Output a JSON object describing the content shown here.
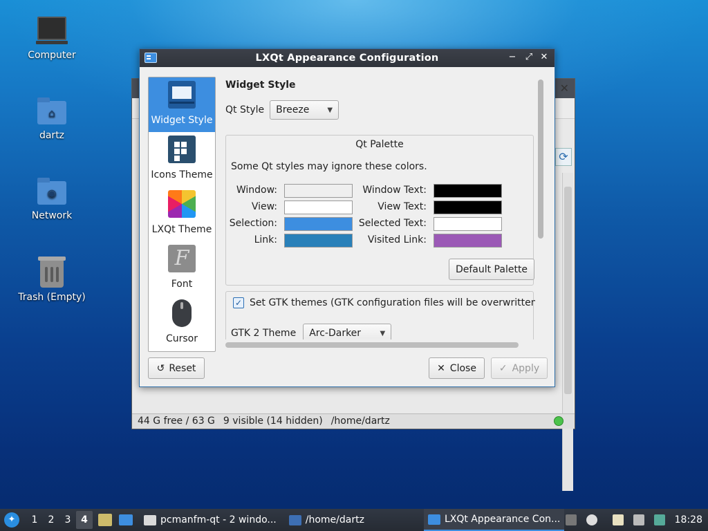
{
  "desktop": {
    "icons": [
      {
        "label": "Computer"
      },
      {
        "label": "dartz"
      },
      {
        "label": "Network"
      },
      {
        "label": "Trash (Empty)"
      }
    ]
  },
  "background_window": {
    "status": {
      "free": "44 G free / 63 G",
      "visible": "9 visible (14 hidden)",
      "path": "/home/dartz"
    }
  },
  "dialog": {
    "title": "LXQt Appearance Configuration",
    "sidebar": [
      {
        "label": "Widget Style",
        "icon": "widget-style-icon"
      },
      {
        "label": "Icons Theme",
        "icon": "icons-theme-icon"
      },
      {
        "label": "LXQt Theme",
        "icon": "lxqt-theme-icon"
      },
      {
        "label": "Font",
        "icon": "font-icon"
      },
      {
        "label": "Cursor",
        "icon": "cursor-icon"
      }
    ],
    "section_title": "Widget Style",
    "qt_style_label": "Qt Style",
    "qt_style_value": "Breeze",
    "palette": {
      "title": "Qt Palette",
      "hint": "Some Qt styles may ignore these colors.",
      "rows": [
        {
          "left_label": "Window:",
          "left_color": "#efefef",
          "right_label": "Window Text:",
          "right_color": "#000000"
        },
        {
          "left_label": "View:",
          "left_color": "#ffffff",
          "right_label": "View Text:",
          "right_color": "#000000"
        },
        {
          "left_label": "Selection:",
          "left_color": "#3d8ee0",
          "right_label": "Selected Text:",
          "right_color": "#ffffff"
        },
        {
          "left_label": "Link:",
          "left_color": "#2980b9",
          "right_label": "Visited Link:",
          "right_color": "#9b59b6"
        }
      ],
      "default_button": "Default Palette"
    },
    "gtk": {
      "checkbox_label": "Set GTK themes (GTK configuration files will be overwritten!)",
      "checked": true,
      "gtk2_label": "GTK 2 Theme",
      "gtk2_value": "Arc-Darker"
    },
    "buttons": {
      "reset": "Reset",
      "close": "Close",
      "apply": "Apply"
    }
  },
  "taskbar": {
    "desktops": [
      "1",
      "2",
      "3",
      "4"
    ],
    "active_desktop": "4",
    "tasks": [
      {
        "label": "pcmanfm-qt - 2 windo..."
      },
      {
        "label": "/home/dartz"
      },
      {
        "label": "LXQt Appearance Con..."
      }
    ],
    "clock": "18:28"
  }
}
